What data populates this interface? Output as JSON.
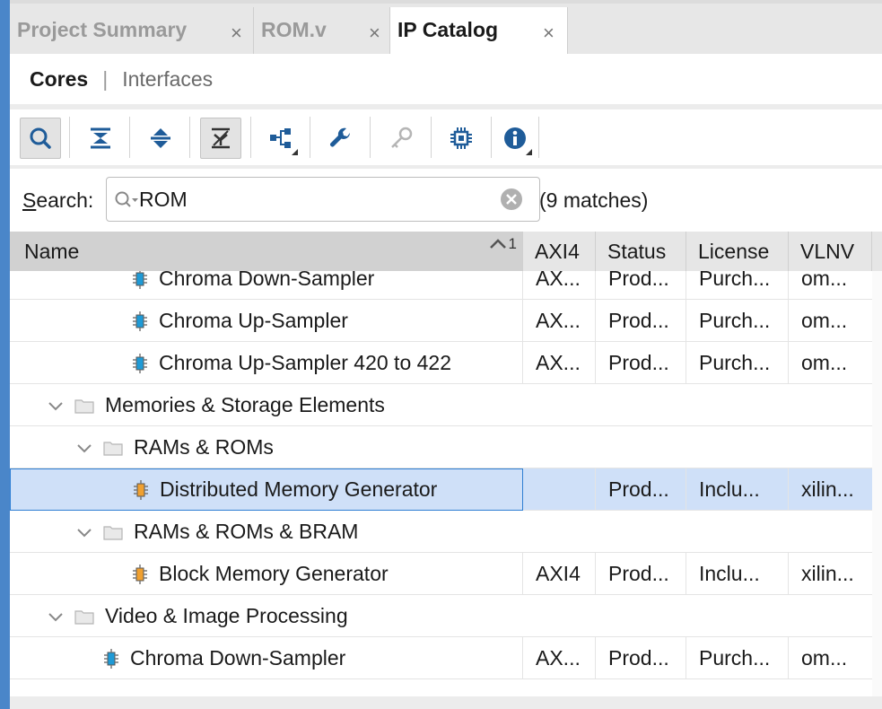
{
  "tabs": [
    {
      "label": "Project Summary",
      "close": "×",
      "active": false
    },
    {
      "label": "ROM.v",
      "close": "×",
      "active": false
    },
    {
      "label": "IP Catalog",
      "close": "×",
      "active": true
    }
  ],
  "subtabs": {
    "active": "Cores",
    "separator": "|",
    "other": "Interfaces"
  },
  "toolbar": {
    "buttons": [
      {
        "icon": "search-icon",
        "pressed": true
      },
      {
        "icon": "collapse-all-icon"
      },
      {
        "icon": "expand-all-icon"
      },
      {
        "icon": "filter-icon",
        "pressed": true
      },
      {
        "icon": "hierarchy-icon"
      },
      {
        "icon": "wrench-icon"
      },
      {
        "icon": "key-icon",
        "disabled": true
      },
      {
        "icon": "chip-icon"
      },
      {
        "icon": "info-icon"
      }
    ]
  },
  "search": {
    "label_prefix": "S",
    "label_rest": "earch:",
    "value": "ROM",
    "matches": "(9 matches)"
  },
  "table": {
    "columns": {
      "name": "Name",
      "sort": "1",
      "axi4": "AXI4",
      "status": "Status",
      "license": "License",
      "vlnv": "VLNV"
    },
    "rows": [
      {
        "type": "core",
        "level": 3,
        "color": "blue",
        "name": "Chroma Down-Sampler",
        "axi4": "AX...",
        "status": "Prod...",
        "license": "Purch...",
        "vlnv": "om..."
      },
      {
        "type": "core",
        "level": 3,
        "color": "blue",
        "name": "Chroma Up-Sampler",
        "axi4": "AX...",
        "status": "Prod...",
        "license": "Purch...",
        "vlnv": "om..."
      },
      {
        "type": "core",
        "level": 3,
        "color": "blue",
        "name": "Chroma Up-Sampler 420 to 422",
        "axi4": "AX...",
        "status": "Prod...",
        "license": "Purch...",
        "vlnv": "om..."
      },
      {
        "type": "group",
        "level": 1,
        "name": "Memories & Storage Elements"
      },
      {
        "type": "group",
        "level": 2,
        "name": "RAMs & ROMs"
      },
      {
        "type": "core",
        "level": 3,
        "color": "orange",
        "selected": true,
        "name": "Distributed Memory Generator",
        "axi4": "",
        "status": "Prod...",
        "license": "Inclu...",
        "vlnv": "xilin..."
      },
      {
        "type": "group",
        "level": 2,
        "name": "RAMs & ROMs & BRAM"
      },
      {
        "type": "core",
        "level": 3,
        "color": "orange",
        "name": "Block Memory Generator",
        "axi4": "AXI4",
        "status": "Prod...",
        "license": "Inclu...",
        "vlnv": "xilin..."
      },
      {
        "type": "group",
        "level": 1,
        "name": "Video & Image Processing"
      },
      {
        "type": "core",
        "level": 2,
        "color": "blue",
        "name": "Chroma Down-Sampler",
        "axi4": "AX...",
        "status": "Prod...",
        "license": "Purch...",
        "vlnv": "om..."
      }
    ]
  },
  "colors": {
    "accent": "#4a86c9",
    "selected_row": "#cfe0f8",
    "core_blue": "#1f9ad6",
    "core_orange": "#f0a030"
  }
}
